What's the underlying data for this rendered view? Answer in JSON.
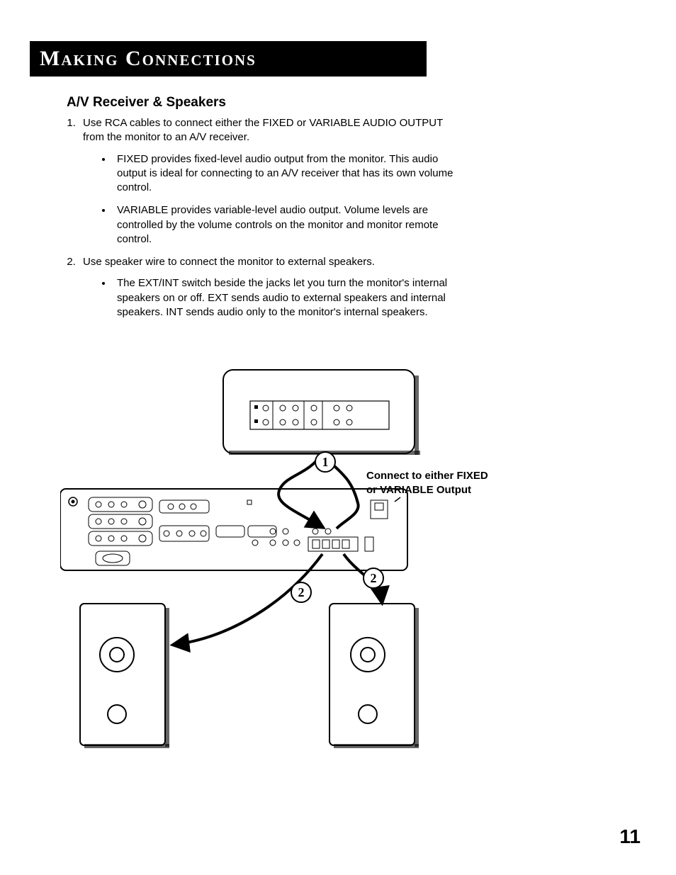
{
  "header": {
    "title": "Making Connections"
  },
  "section": {
    "title": "A/V Receiver & Speakers"
  },
  "steps": [
    {
      "text": "Use RCA cables to connect either the FIXED or VARIABLE AUDIO OUTPUT from the monitor to an A/V receiver.",
      "bullets": [
        "FIXED provides fixed-level audio output from the monitor. This audio output is ideal for connecting to an A/V receiver that has its own volume control.",
        "VARIABLE provides variable-level audio output. Volume levels are controlled by the volume controls on the monitor and monitor remote control."
      ]
    },
    {
      "text": "Use speaker wire to connect the monitor to external speakers.",
      "bullets": [
        "The EXT/INT switch beside the jacks let you turn the monitor's internal speakers on or off. EXT sends audio to external speakers and internal speakers. INT sends audio only to the monitor's internal speakers."
      ]
    }
  ],
  "diagram": {
    "callout1": "1",
    "callout2a": "2",
    "callout2b": "2",
    "caption_line1": "Connect to either FIXED",
    "caption_line2": "or VARIABLE Output"
  },
  "page_number": "11"
}
